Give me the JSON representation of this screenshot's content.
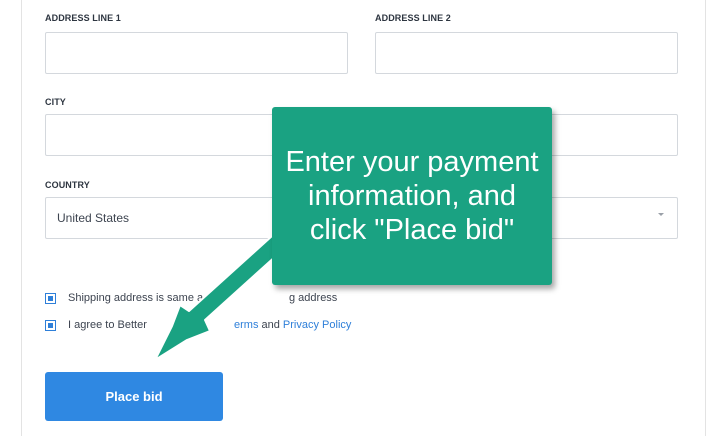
{
  "form": {
    "address_line1_label": "ADDRESS LINE 1",
    "address_line2_label": "ADDRESS LINE 2",
    "city_label": "CITY",
    "country_label": "COUNTRY",
    "country_value": "United States",
    "address_line1_value": "",
    "address_line2_value": "",
    "city_value": ""
  },
  "checkboxes": {
    "shipping": {
      "checked": true,
      "text_visible_left": "Shipping address is same a",
      "text_visible_right": "g address"
    },
    "agree": {
      "checked": true,
      "text_visible_left": "I agree to Better",
      "terms_link_partial": "erms",
      "and_text": " and ",
      "privacy_link": "Privacy Policy"
    }
  },
  "button": {
    "label": "Place bid"
  },
  "callout": {
    "text": "Enter your payment information, and click \"Place bid\"",
    "color": "#1aa282"
  },
  "colors": {
    "primary": "#2f88e2",
    "link": "#2e7fd9"
  }
}
